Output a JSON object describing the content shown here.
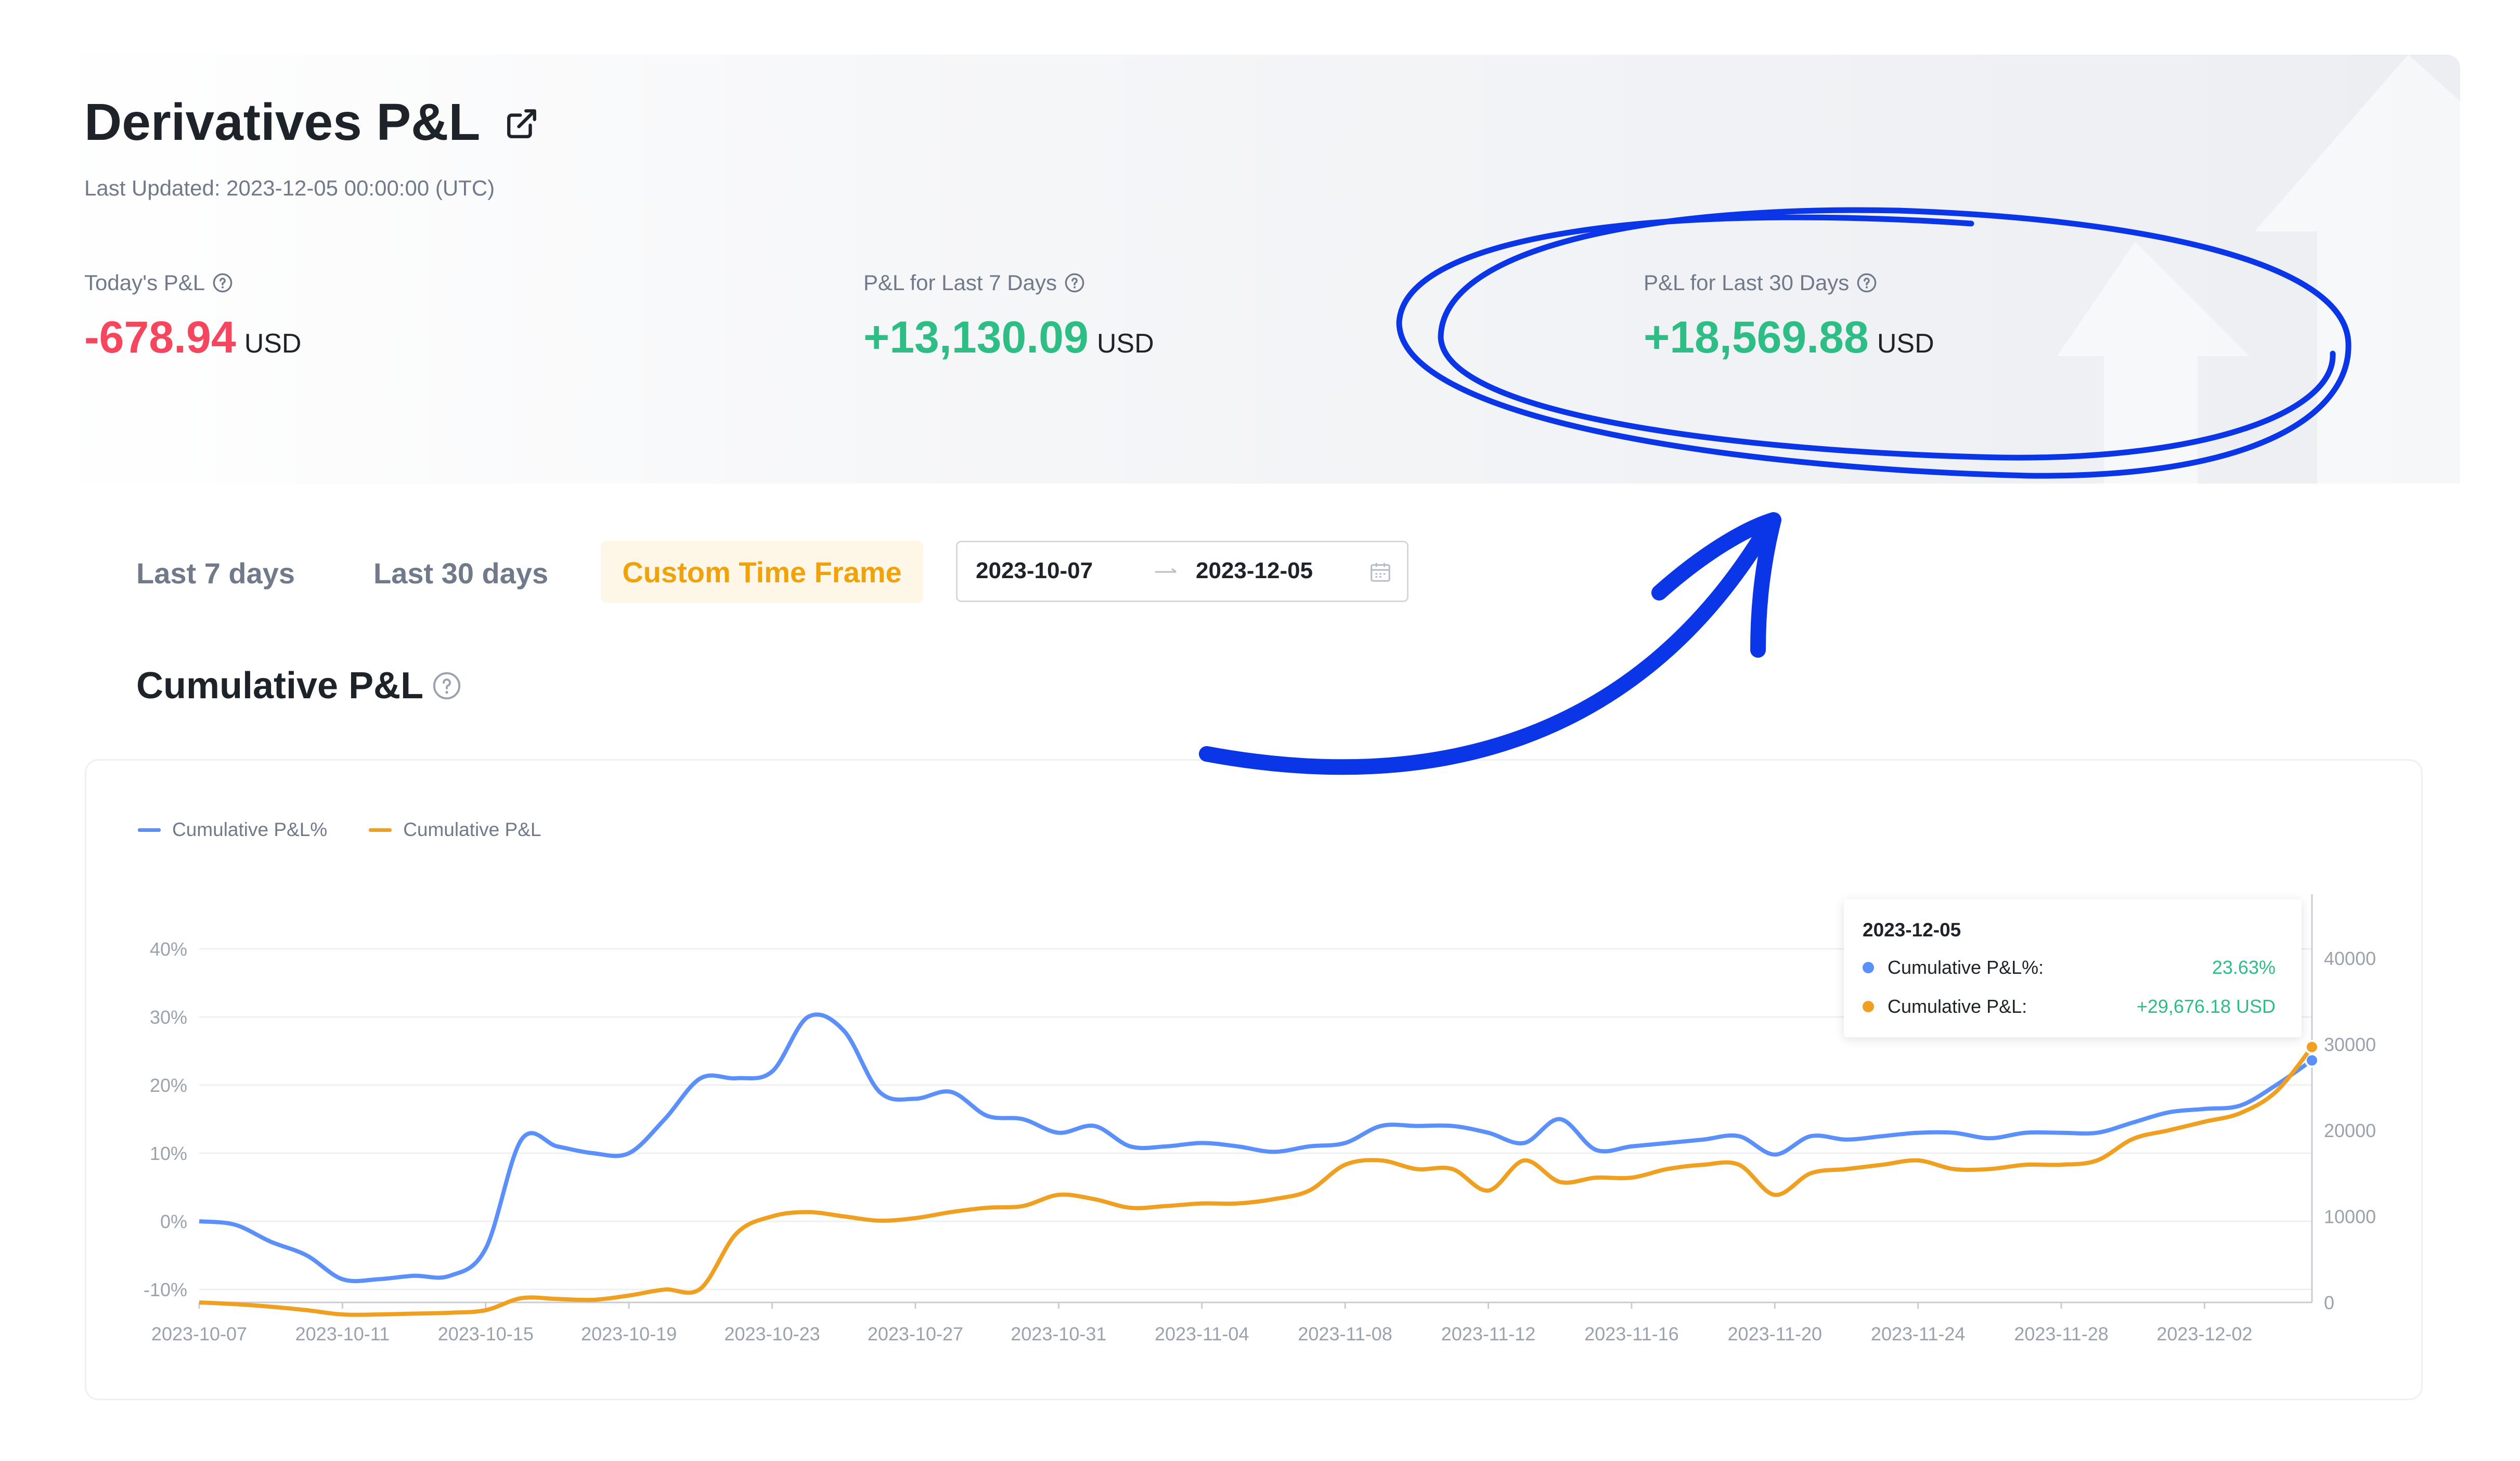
{
  "header": {
    "title": "Derivatives P&L",
    "last_updated": "Last Updated: 2023-12-05 00:00:00 (UTC)"
  },
  "stats": [
    {
      "label": "Today's P&L",
      "value": "-678.94",
      "unit": "USD"
    },
    {
      "label": "P&L for Last 7 Days",
      "value": "+13,130.09",
      "unit": "USD"
    },
    {
      "label": "P&L for Last 30 Days",
      "value": "+18,569.88",
      "unit": "USD"
    }
  ],
  "tabs": [
    "Last 7 days",
    "Last 30 days",
    "Custom Time Frame"
  ],
  "date_range": {
    "start": "2023-10-07",
    "end": "2023-12-05"
  },
  "colors": {
    "negative": "#f6465d",
    "positive": "#2ebd85",
    "accent": "#f0a20b",
    "series_pct": "#5b8ff9",
    "series_pnl": "#f0a020",
    "annotation": "#0a36e8"
  },
  "tooltip": {
    "date": "2023-12-05",
    "rows": [
      {
        "label": "Cumulative P&L%:",
        "value": "23.63%"
      },
      {
        "label": "Cumulative P&L:",
        "value": "+29,676.18 USD"
      }
    ]
  },
  "chart_data": {
    "type": "line",
    "title": "Cumulative P&L",
    "x": [
      "2023-10-07",
      "2023-10-08",
      "2023-10-09",
      "2023-10-10",
      "2023-10-11",
      "2023-10-12",
      "2023-10-13",
      "2023-10-14",
      "2023-10-15",
      "2023-10-16",
      "2023-10-17",
      "2023-10-18",
      "2023-10-19",
      "2023-10-20",
      "2023-10-21",
      "2023-10-22",
      "2023-10-23",
      "2023-10-24",
      "2023-10-25",
      "2023-10-26",
      "2023-10-27",
      "2023-10-28",
      "2023-10-29",
      "2023-10-30",
      "2023-10-31",
      "2023-11-01",
      "2023-11-02",
      "2023-11-03",
      "2023-11-04",
      "2023-11-05",
      "2023-11-06",
      "2023-11-07",
      "2023-11-08",
      "2023-11-09",
      "2023-11-10",
      "2023-11-11",
      "2023-11-12",
      "2023-11-13",
      "2023-11-14",
      "2023-11-15",
      "2023-11-16",
      "2023-11-17",
      "2023-11-18",
      "2023-11-19",
      "2023-11-20",
      "2023-11-21",
      "2023-11-22",
      "2023-11-23",
      "2023-11-24",
      "2023-11-25",
      "2023-11-26",
      "2023-11-27",
      "2023-11-28",
      "2023-11-29",
      "2023-11-30",
      "2023-12-01",
      "2023-12-02",
      "2023-12-03",
      "2023-12-04",
      "2023-12-05"
    ],
    "x_ticks": [
      "2023-10-07",
      "2023-10-11",
      "2023-10-15",
      "2023-10-19",
      "2023-10-23",
      "2023-10-27",
      "2023-10-31",
      "2023-11-04",
      "2023-11-08",
      "2023-11-12",
      "2023-11-16",
      "2023-11-20",
      "2023-11-24",
      "2023-11-28",
      "2023-12-02"
    ],
    "series": [
      {
        "name": "Cumulative P&L%",
        "axis": "left",
        "values": [
          0,
          -0.5,
          -3,
          -5,
          -8.5,
          -8.5,
          -8,
          -8,
          -4,
          12,
          11,
          10,
          10,
          15,
          21,
          21,
          22,
          30,
          28,
          19,
          18,
          19,
          15.5,
          15,
          13,
          14,
          11,
          11,
          11.5,
          11,
          10.2,
          11,
          11.5,
          14,
          14,
          14,
          13,
          11.5,
          15,
          10.5,
          11,
          11.5,
          12,
          12.5,
          9.8,
          12.5,
          12,
          12.5,
          13,
          13,
          12.2,
          13,
          13,
          13,
          14.5,
          16,
          16.5,
          17,
          20,
          23.63
        ]
      },
      {
        "name": "Cumulative P&L",
        "axis": "right",
        "values": [
          0,
          -200,
          -500,
          -900,
          -1400,
          -1400,
          -1300,
          -1200,
          -900,
          500,
          400,
          300,
          800,
          1500,
          1600,
          8000,
          10000,
          10500,
          10000,
          9500,
          9800,
          10500,
          11000,
          11200,
          12500,
          12000,
          11000,
          11200,
          11500,
          11500,
          12000,
          13000,
          16000,
          16500,
          15500,
          15500,
          13000,
          16500,
          14000,
          14500,
          14500,
          15500,
          16000,
          16000,
          12500,
          15000,
          15500,
          16000,
          16500,
          15500,
          15500,
          16000,
          16000,
          16500,
          19000,
          20000,
          21000,
          22000,
          24500,
          29676.18
        ]
      }
    ],
    "left_axis": {
      "ticks": [
        "40%",
        "30%",
        "20%",
        "10%",
        "0%",
        "-10%"
      ],
      "range": [
        -10,
        40
      ]
    },
    "right_axis": {
      "ticks": [
        "40000",
        "30000",
        "20000",
        "10000",
        "0"
      ],
      "range": [
        0,
        40000
      ]
    },
    "legend": "top-left",
    "grid": true
  }
}
